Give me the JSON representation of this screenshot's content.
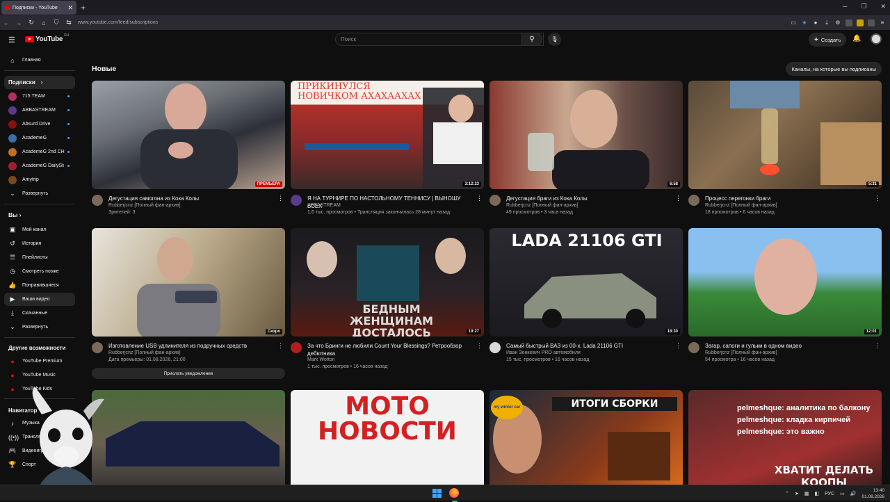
{
  "browser": {
    "tab_title": "Подписки - YouTube",
    "url": "www.youtube.com/feed/subscriptions"
  },
  "masthead": {
    "logo_text": "YouTube",
    "logo_region": "RU",
    "search_placeholder": "Поиск",
    "create_label": "Создать"
  },
  "sidebar": {
    "home": "Главная",
    "subs_header": "Подписки",
    "channels": [
      {
        "name": "715 TEAM",
        "color": "#b03060"
      },
      {
        "name": "ABBASTREAM",
        "color": "#5a3a8a"
      },
      {
        "name": "Absurd Drive",
        "color": "#8a1010"
      },
      {
        "name": "AcademeG",
        "color": "#3a6ea8"
      },
      {
        "name": "AcademeG 2nd CH",
        "color": "#c07020"
      },
      {
        "name": "AcademeG DailyStream",
        "color": "#a02030"
      },
      {
        "name": "Amytrip",
        "color": "#7a4a20"
      }
    ],
    "expand_label": "Развернуть",
    "you_header": "Вы",
    "you_items": [
      "Мой канал",
      "История",
      "Плейлисты",
      "Смотреть позже",
      "Понравившиеся",
      "Ваши видео",
      "Скачанные",
      "Развернуть"
    ],
    "more_header": "Другие возможности",
    "more_items": [
      "YouTube Premium",
      "YouTube Music",
      "YouTube Kids"
    ],
    "nav_header": "Навигатор",
    "nav_items": [
      "Музыка",
      "Трансляции",
      "Видеоигры",
      "Спорт"
    ]
  },
  "content": {
    "section_title": "Новые",
    "subs_button": "Каналы, на которые вы подписаны"
  },
  "videos": [
    {
      "title": "Дегустация самогона из Кока Колы",
      "channel": "Rubberjcnz [Полный фан-архив]",
      "stats": "Зрителей: 3",
      "badge": "ПРЕМЬЕРА"
    },
    {
      "title": "Я НА ТУРНИРЕ ПО НАСТОЛЬНОМУ ТЕННИСУ | ВЫНОШУ ВСЕХ",
      "channel": "ABBASTREAM",
      "stats": "1,6 тыс. просмотров • Трансляция закончилась 28 минут назад",
      "duration": "3:12:23",
      "overlay": "ПРИКИНУЛСЯ НОВИЧКОМ АХАХААХАХ"
    },
    {
      "title": "Дегустация браги из Кока Колы",
      "channel": "Rubberjcnz [Полный фан-архив]",
      "stats": "49 просмотров • 3 часа назад",
      "duration": "6:58"
    },
    {
      "title": "Процесс перегонки браги",
      "channel": "Rubberjcnz [Полный фан-архив]",
      "stats": "18 просмотров • 6 часов назад",
      "duration": "5:31"
    },
    {
      "title": "Изготовление USB удлинителя из подручных средств",
      "channel": "Rubberjcnz [Полный фан-архив]",
      "stats": "Дата премьеры: 01.08.2026, 21:00",
      "duration": "Скоро",
      "button": "Прислать уведомление"
    },
    {
      "title": "За что Бринги не любили Count Your Blessings? Ретрообзор дебютника",
      "channel": "Mark Wotton",
      "stats": "1 тыс. просмотров • 16 часов назад",
      "duration": "19:27",
      "overlay": "БЕДНЫМ ЖЕНЩИНАМ ДОСТАЛОСЬ"
    },
    {
      "title": "Самый быстрый ВАЗ из 00-х. Lada 21106 GTI",
      "channel": "Иван Зенкевич PRO автомобили",
      "stats": "15 тыс. просмотров • 16 часов назад",
      "duration": "18:30",
      "overlay": "LADA 21106 GTI"
    },
    {
      "title": "Загар, сапоги и гульки в одном видео",
      "channel": "Rubberjcnz [Полный фан-архив]",
      "stats": "54 просмотра • 16 часов назад",
      "duration": "12:01"
    },
    {
      "overlay": "МОТО НОВОСТИ"
    },
    {
      "overlay": "ИТОГИ СБОРКИ",
      "logo": "my winter car"
    },
    {
      "overlay": "ХВАТИТ ДЕЛАТЬ КООПЫ",
      "chat": [
        "pelmeshque: аналитика по балкону",
        "pelmeshque: кладка кирпичей",
        "pelmeshque: это важно"
      ]
    }
  ],
  "taskbar": {
    "lang": "РУС",
    "time": "13:40",
    "date": "01.08.2026"
  },
  "colors": {
    "accent": "#3ea6ff",
    "brand": "#ff0000",
    "background": "#0f0f0f"
  }
}
